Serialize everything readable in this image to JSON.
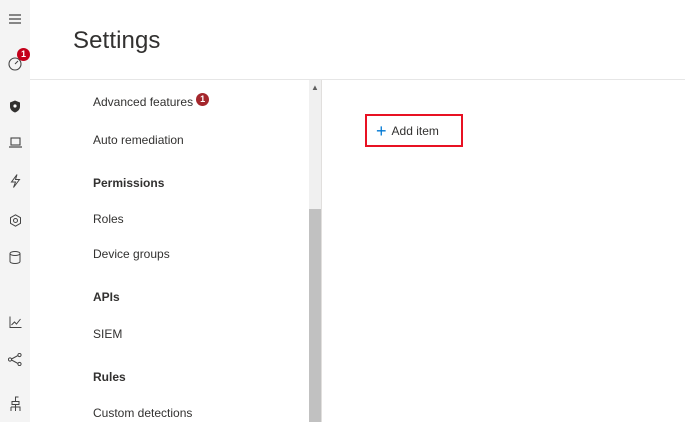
{
  "header": {
    "title": "Settings"
  },
  "rail": {
    "items": [
      {
        "icon": "hamburger-menu-icon"
      },
      {
        "icon": "dashboard-gauge-icon",
        "badge": "1"
      },
      {
        "icon": "shield-icon"
      },
      {
        "icon": "laptop-icon"
      },
      {
        "icon": "lightning-icon"
      },
      {
        "icon": "hexagon-icon"
      },
      {
        "icon": "database-icon"
      },
      {
        "icon": "line-chart-icon"
      },
      {
        "icon": "share-nodes-icon"
      },
      {
        "icon": "network-tree-icon"
      }
    ]
  },
  "nav": {
    "advanced_features": "Advanced features",
    "advanced_features_badge": "1",
    "auto_remediation": "Auto remediation",
    "permissions_heading": "Permissions",
    "roles": "Roles",
    "device_groups": "Device groups",
    "apis_heading": "APIs",
    "siem": "SIEM",
    "rules_heading": "Rules",
    "custom_detections": "Custom detections"
  },
  "content": {
    "add_item_label": "Add item"
  },
  "colors": {
    "accent": "#0078d4",
    "highlight_border": "#e81123",
    "badge": "#a4262c"
  }
}
